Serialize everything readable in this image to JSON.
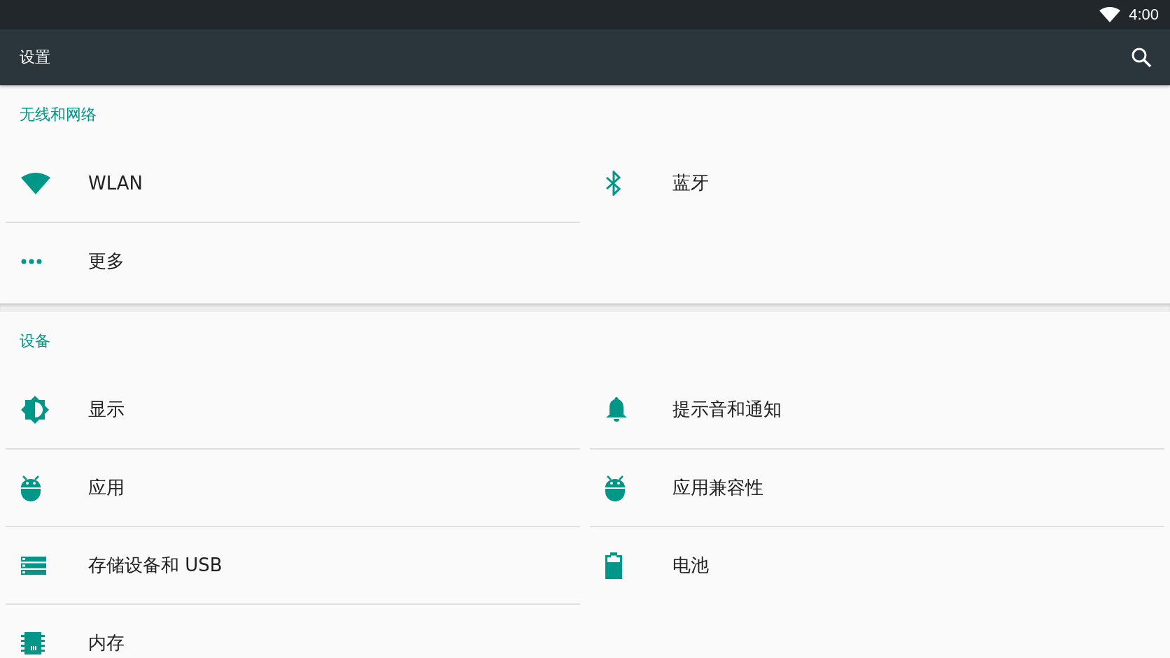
{
  "status_bar": {
    "time": "4:00"
  },
  "toolbar": {
    "title": "设置"
  },
  "sections": [
    {
      "title": "无线和网络",
      "items": [
        {
          "label": "WLAN"
        },
        {
          "label": "蓝牙"
        },
        {
          "label": "更多"
        }
      ]
    },
    {
      "title": "设备",
      "items": [
        {
          "label": "显示"
        },
        {
          "label": "提示音和通知"
        },
        {
          "label": "应用"
        },
        {
          "label": "应用兼容性"
        },
        {
          "label": "存储设备和 USB"
        },
        {
          "label": "电池"
        },
        {
          "label": "内存"
        }
      ]
    }
  ]
}
